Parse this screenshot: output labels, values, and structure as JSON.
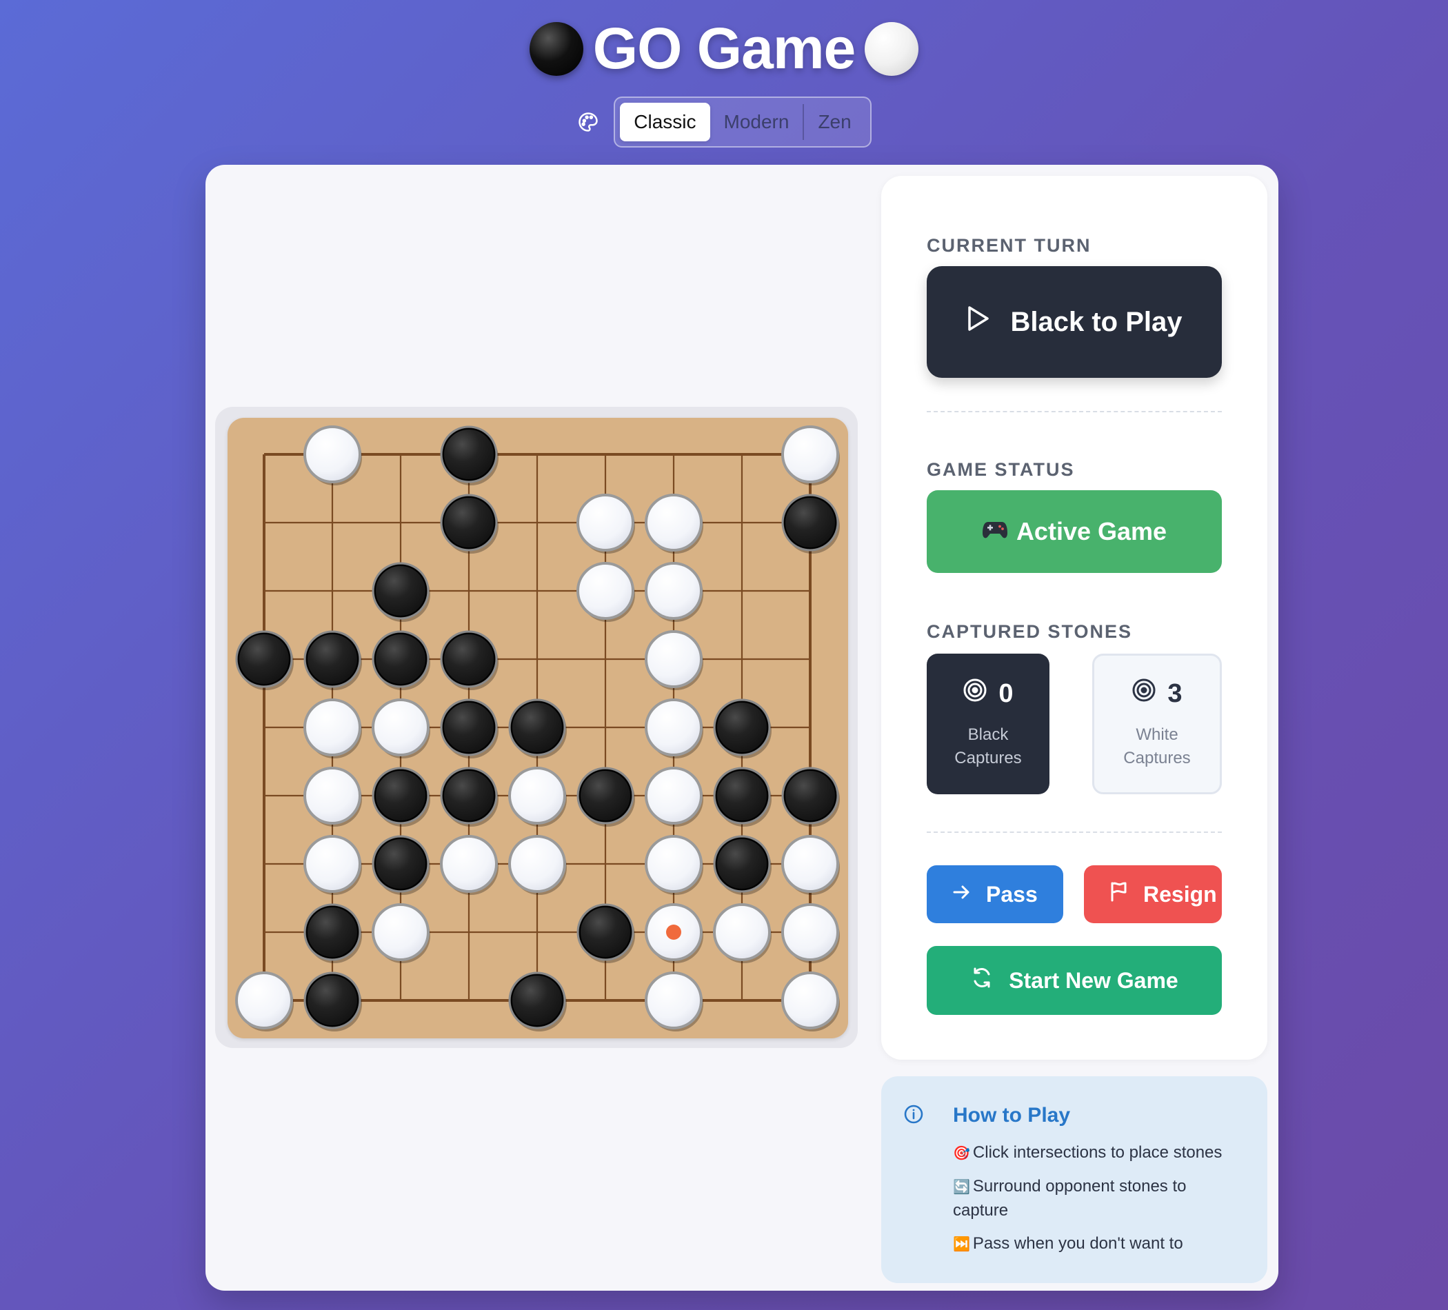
{
  "header": {
    "title": "GO Game"
  },
  "theme": {
    "options": [
      "Classic",
      "Modern",
      "Zen"
    ],
    "selected": "Classic"
  },
  "board": {
    "size": 9,
    "stones": [
      ".W.B....W",
      "...B.WW.B",
      "..B..WW..",
      "BBBB..W..",
      ".WWBB.WB.",
      ".WBBWBWBB",
      ".WBWW.WBW",
      ".BW..BWWW",
      "WB..B.W.W"
    ],
    "last_move": {
      "row": 7,
      "col": 6
    },
    "last_move_color": "#f06a3c",
    "wood_color": "#d8b285",
    "line_color": "#7a4a22"
  },
  "panel": {
    "current_turn_label": "CURRENT TURN",
    "turn_text": "Black to Play",
    "game_status_label": "GAME STATUS",
    "status_text": "Active Game",
    "captured_label": "CAPTURED STONES",
    "black_captures": {
      "count": "0",
      "label_line1": "Black",
      "label_line2": "Captures"
    },
    "white_captures": {
      "count": "3",
      "label_line1": "White",
      "label_line2": "Captures"
    },
    "pass_label": "Pass",
    "resign_label": "Resign",
    "new_game_label": "Start New Game"
  },
  "help": {
    "title": "How to Play",
    "items": [
      {
        "emoji": "🎯",
        "text": "Click intersections to place stones"
      },
      {
        "emoji": "🔄",
        "text": "Surround opponent stones to capture"
      },
      {
        "emoji": "⏭️",
        "text": "Pass when you don't want to"
      }
    ]
  },
  "colors": {
    "turn_bg": "#272d3b",
    "status_green": "#48b26c",
    "pass_blue": "#2f7fdd",
    "resign_red": "#ef5251",
    "new_game_green": "#23ae79",
    "help_title": "#2877c8"
  }
}
